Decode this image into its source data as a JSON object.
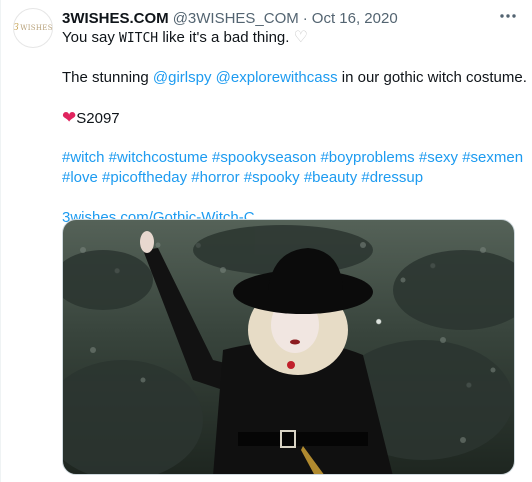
{
  "tweet": {
    "display_name": "3WISHES.COM",
    "handle": "@3WISHES_COM",
    "separator": "·",
    "date": "Oct 16, 2020",
    "more_icon": "more-horizontal-icon",
    "avatar_text": "WISHES",
    "avatar_prefix": "3",
    "line1_a": "You say",
    "line1_code": "WITCH",
    "line1_b": "like it's a bad thing.",
    "line2_a": "The stunning",
    "mention1": "@girlspy",
    "mention2": "@explorewithcass",
    "line2_b": "in our gothic witch costume.",
    "sku": "S2097",
    "hashtags_line1": "#witch #witchcostume #spookyseason #boyproblems #sexy #sexmen",
    "hashtags_line2": "#love #picoftheday  #horror #spooky #beauty #dressup",
    "link": "3wishes.com/Gothic-Witch-C...",
    "heart_outline_icon": "white-heart-icon",
    "heart_red_icon": "red-heart-icon",
    "media_alt": "photo"
  },
  "colors": {
    "link": "#1d9bf0",
    "text": "#0f1419",
    "muted": "#536471",
    "heart": "#e0245e"
  }
}
